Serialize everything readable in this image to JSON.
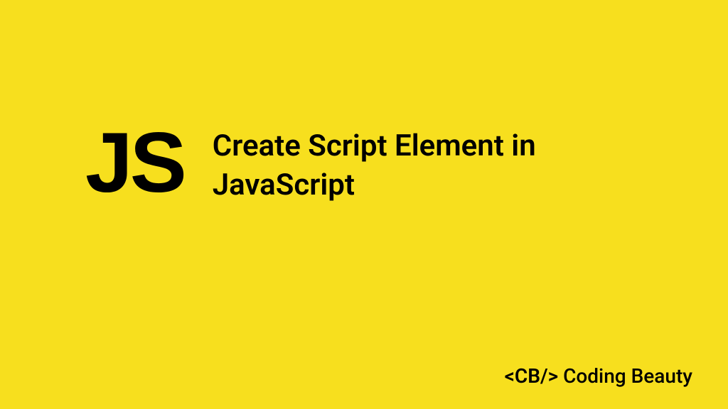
{
  "logo": {
    "text": "JS"
  },
  "title": {
    "line1": "Create Script Element in",
    "line2": "JavaScript"
  },
  "brand": {
    "tag": "<CB/>",
    "name": "Coding Beauty"
  },
  "colors": {
    "background": "#F7DF1E",
    "foreground": "#000000"
  }
}
